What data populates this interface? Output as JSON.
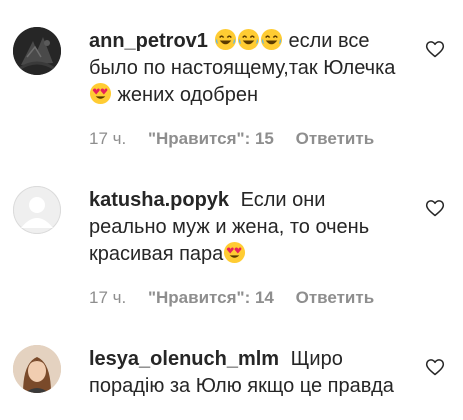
{
  "comments": [
    {
      "username": "ann_petrov1",
      "text_before": "",
      "emoji_run": [
        "tears-of-joy-emoji",
        "tears-of-joy-emoji",
        "tears-of-joy-emoji"
      ],
      "text_1": " если все было по настоящему,так Юлечка ",
      "text_2": " жених одобрен",
      "time": "17 ч.",
      "likes": "\"Нравится\": 15",
      "reply": "Ответить"
    },
    {
      "username": "katusha.popyk",
      "text_1": " Если они реально муж и жена, то очень красивая пара",
      "time": "17 ч.",
      "likes": "\"Нравится\": 14",
      "reply": "Ответить"
    },
    {
      "username": "lesya_olenuch_mlm",
      "text_1": " Щиро порадію за Юлю якщо це правда",
      "time": "",
      "likes": "",
      "reply": ""
    }
  ],
  "icons": {
    "like": "heart-outline-icon",
    "emoji_laugh": "tears-of-joy-emoji",
    "emoji_love": "heart-eyes-emoji"
  },
  "colors": {
    "text": "#262626",
    "secondary": "#8e8e8e"
  }
}
